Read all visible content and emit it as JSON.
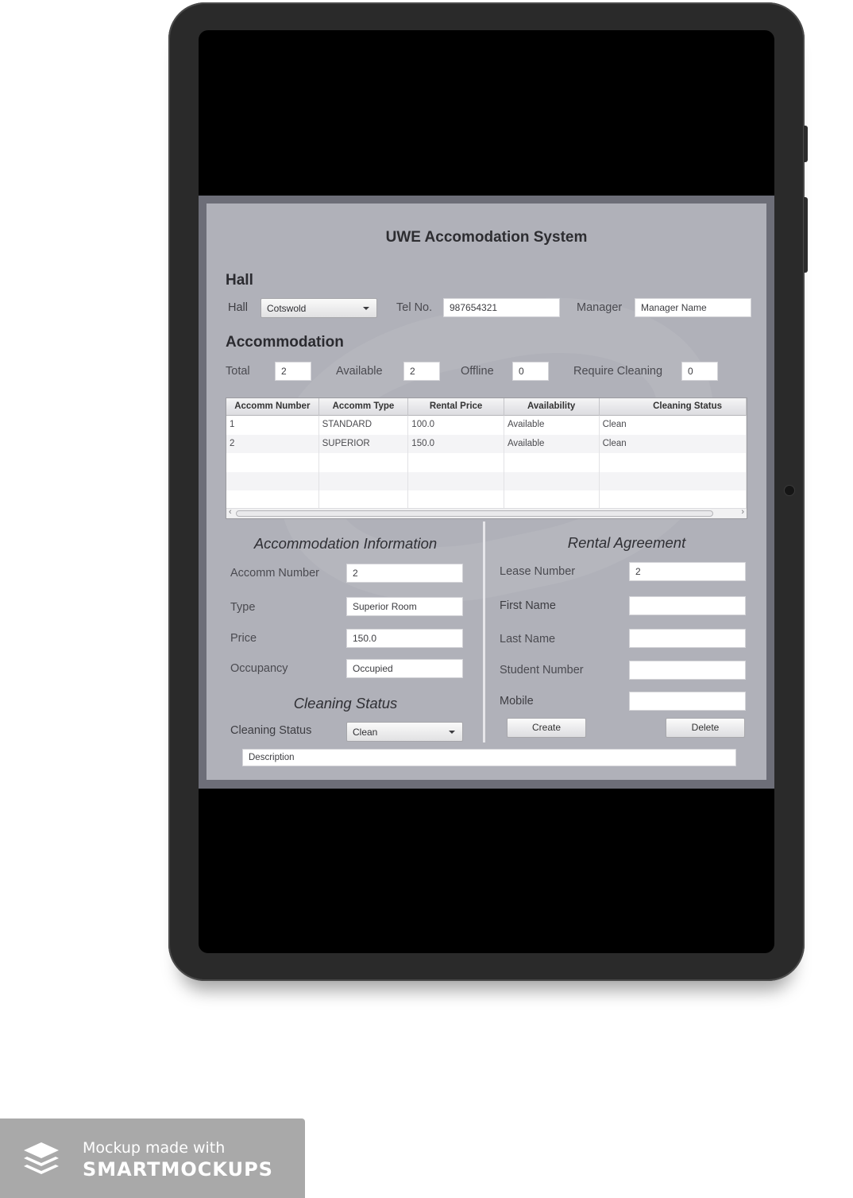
{
  "app": {
    "title": "UWE Accomodation System",
    "hall_section": {
      "heading": "Hall",
      "hall_label": "Hall",
      "hall_value": "Cotswold",
      "tel_label": "Tel No.",
      "tel_value": "987654321",
      "manager_label": "Manager",
      "manager_value": "Manager Name"
    },
    "accommodation_section": {
      "heading": "Accommodation",
      "total_label": "Total",
      "total_value": "2",
      "available_label": "Available",
      "available_value": "2",
      "offline_label": "Offline",
      "offline_value": "0",
      "require_cleaning_label": "Require Cleaning",
      "require_cleaning_value": "0"
    },
    "table": {
      "columns": [
        "Accomm Number",
        "Accomm Type",
        "Rental Price",
        "Availability",
        "Cleaning Status"
      ],
      "rows": [
        [
          "1",
          "STANDARD",
          "100.0",
          "Available",
          "Clean"
        ],
        [
          "2",
          "SUPERIOR",
          "150.0",
          "Available",
          "Clean"
        ]
      ]
    },
    "accommodation_info": {
      "heading": "Accommodation Information",
      "number_label": "Accomm Number",
      "number_value": "2",
      "type_label": "Type",
      "type_value": "Superior Room",
      "price_label": "Price",
      "price_value": "150.0",
      "occupancy_label": "Occupancy",
      "occupancy_value": "Occupied"
    },
    "cleaning": {
      "heading": "Cleaning Status",
      "status_label": "Cleaning Status",
      "status_value": "Clean"
    },
    "rental_agreement": {
      "heading": "Rental Agreement",
      "lease_label": "Lease Number",
      "lease_value": "2",
      "first_name_label": "First Name",
      "first_name_value": "",
      "last_name_label": "Last Name",
      "last_name_value": "",
      "student_number_label": "Student Number",
      "student_number_value": "",
      "mobile_label": "Mobile",
      "mobile_value": "",
      "create_label": "Create",
      "delete_label": "Delete"
    },
    "description_value": "Description"
  },
  "badge": {
    "line1": "Mockup made with",
    "line2": "SMARTMOCKUPS"
  }
}
